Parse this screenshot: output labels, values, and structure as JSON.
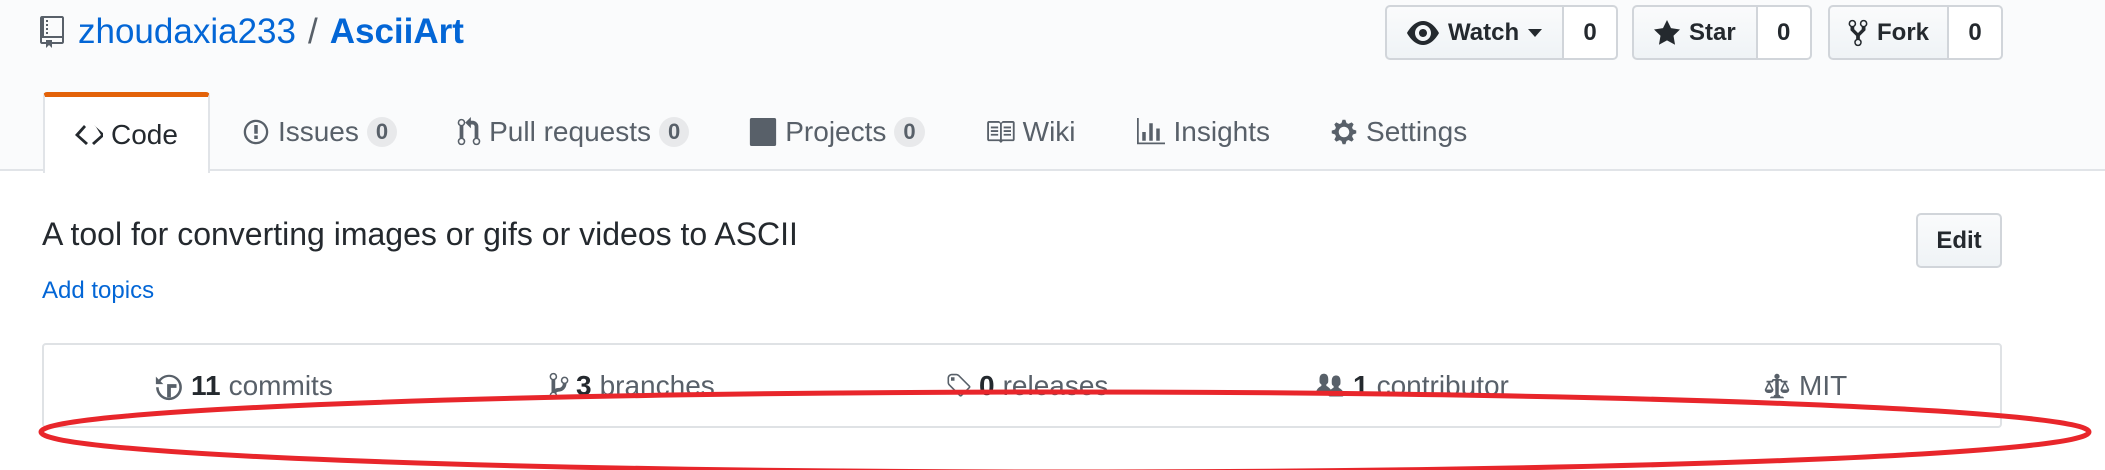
{
  "repo": {
    "owner": "zhoudaxia233",
    "separator": "/",
    "name": "AsciiArt"
  },
  "actions": {
    "watch": {
      "label": "Watch",
      "count": "0"
    },
    "star": {
      "label": "Star",
      "count": "0"
    },
    "fork": {
      "label": "Fork",
      "count": "0"
    }
  },
  "tabs": [
    {
      "label": "Code",
      "icon": "code-icon",
      "selected": true
    },
    {
      "label": "Issues",
      "icon": "issue-icon",
      "counter": "0"
    },
    {
      "label": "Pull requests",
      "icon": "pull-request-icon",
      "counter": "0"
    },
    {
      "label": "Projects",
      "icon": "project-icon",
      "counter": "0"
    },
    {
      "label": "Wiki",
      "icon": "book-icon"
    },
    {
      "label": "Insights",
      "icon": "graph-icon"
    },
    {
      "label": "Settings",
      "icon": "gear-icon"
    }
  ],
  "description": "A tool for converting images or gifs or videos to ASCII",
  "add_topics": "Add topics",
  "edit_label": "Edit",
  "summary": {
    "commits": {
      "num": "11",
      "label": "commits"
    },
    "branches": {
      "num": "3",
      "label": "branches"
    },
    "releases": {
      "num": "0",
      "label": "releases"
    },
    "contributors": {
      "num": "1",
      "label": "contributor"
    },
    "license": {
      "label": "MIT"
    }
  },
  "colors": {
    "link": "#0366d6",
    "selected_tab_accent": "#e36209",
    "annotation": "#e8262b"
  }
}
